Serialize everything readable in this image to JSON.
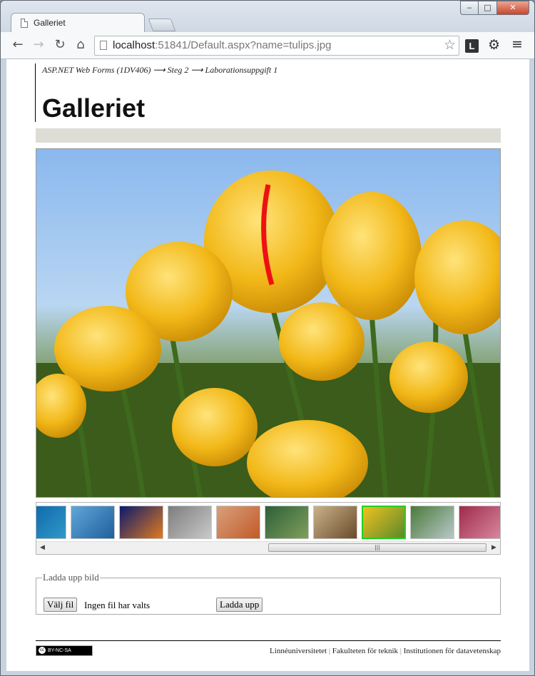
{
  "browser": {
    "tab_title": "Galleriet",
    "url_host": "localhost",
    "url_rest": ":51841/Default.aspx?name=tulips.jpg"
  },
  "page": {
    "breadcrumb": "ASP.NET Web Forms (1DV406) ⟶ Steg 2 ⟶ Laborationsuppgift 1",
    "title": "Galleriet",
    "main_image_name": "tulips.jpg"
  },
  "thumbnails": [
    {
      "subject": "turtle",
      "colors": [
        "#0b5fa8",
        "#2f9ac8"
      ]
    },
    {
      "subject": "whale-tail",
      "colors": [
        "#5fa7d8",
        "#1f5f9e"
      ]
    },
    {
      "subject": "jellyfish",
      "colors": [
        "#0a1a6e",
        "#e07a20"
      ]
    },
    {
      "subject": "koala",
      "colors": [
        "#7d7d7d",
        "#c9c9c9"
      ]
    },
    {
      "subject": "desert",
      "colors": [
        "#d8a07a",
        "#c25a2a"
      ]
    },
    {
      "subject": "toucan",
      "colors": [
        "#2d5e3a",
        "#7fa05a"
      ]
    },
    {
      "subject": "autumn-tree",
      "colors": [
        "#c9b38a",
        "#6a4a2a"
      ]
    },
    {
      "subject": "tulips",
      "colors": [
        "#f0c020",
        "#5a8a2a"
      ],
      "active": true
    },
    {
      "subject": "waterfall",
      "colors": [
        "#4a7a3a",
        "#b8c8c8"
      ]
    },
    {
      "subject": "flower",
      "colors": [
        "#a02a4a",
        "#d88aa0"
      ]
    }
  ],
  "upload": {
    "legend": "Ladda upp bild",
    "choose_label": "Välj fil",
    "no_file_text": "Ingen fil har valts",
    "submit_label": "Ladda upp"
  },
  "footer": {
    "license_text": "BY-NC-SA",
    "link1": "Linnéuniversitetet",
    "link2": "Fakulteten för teknik",
    "link3": "Institutionen för datavetenskap"
  }
}
